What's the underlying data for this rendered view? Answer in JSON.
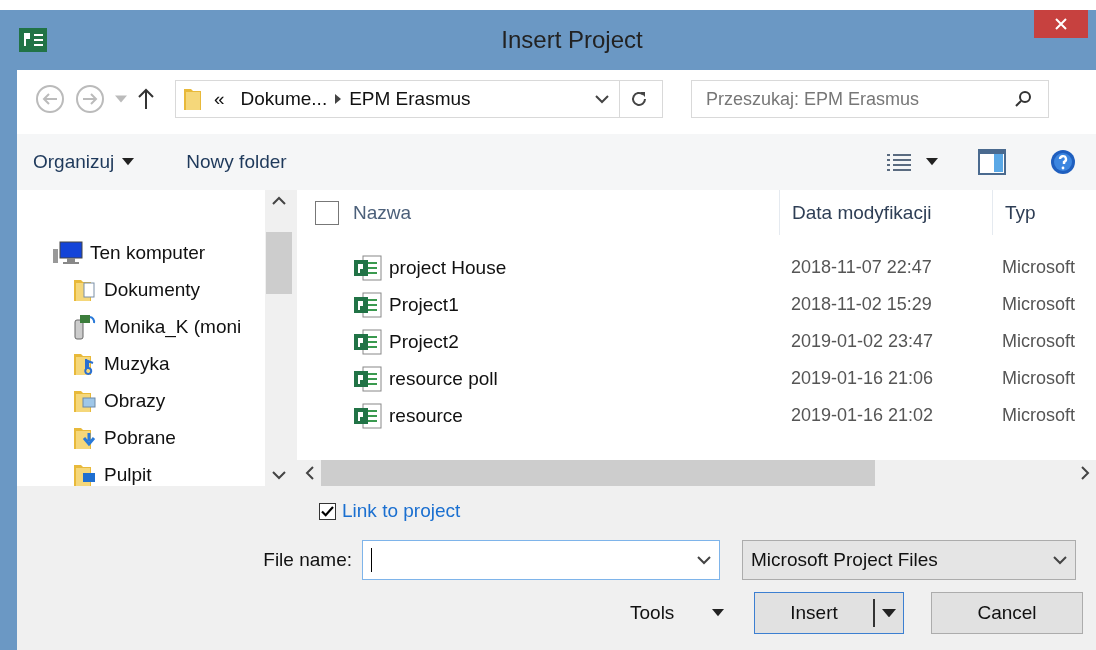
{
  "window": {
    "title": "Insert Project"
  },
  "address": {
    "overflow": "«",
    "crumbs": [
      "Dokume...",
      "EPM Erasmus"
    ]
  },
  "search": {
    "placeholder": "Przeszukaj: EPM Erasmus"
  },
  "toolbar": {
    "organize": "Organizuj",
    "new_folder": "Nowy folder"
  },
  "sidebar": {
    "items": [
      {
        "label": "Ten komputer",
        "kind": "computer",
        "children": [
          {
            "label": "Dokumenty",
            "kind": "documents"
          },
          {
            "label": "Monika_K (moni",
            "kind": "network"
          },
          {
            "label": "Muzyka",
            "kind": "music"
          },
          {
            "label": "Obrazy",
            "kind": "pictures"
          },
          {
            "label": "Pobrane",
            "kind": "downloads"
          },
          {
            "label": "Pulpit",
            "kind": "desktop"
          }
        ]
      }
    ]
  },
  "table": {
    "select_all": {
      "checked": false
    },
    "columns": [
      "Nazwa",
      "Data modyfikacji",
      "Typ"
    ],
    "rows": [
      {
        "name": "project House",
        "date": "2018-11-07 22:47",
        "type": "Microsoft"
      },
      {
        "name": "Project1",
        "date": "2018-11-02 15:29",
        "type": "Microsoft"
      },
      {
        "name": "Project2",
        "date": "2019-01-02 23:47",
        "type": "Microsoft"
      },
      {
        "name": "resource poll",
        "date": "2019-01-16 21:06",
        "type": "Microsoft"
      },
      {
        "name": "resource",
        "date": "2019-01-16 21:02",
        "type": "Microsoft"
      }
    ]
  },
  "link_option": {
    "label": "Link to project",
    "checked": true
  },
  "file_name": {
    "label": "File name:"
  },
  "file_type": {
    "value": "Microsoft Project Files"
  },
  "buttons": {
    "tools": "Tools",
    "insert": "Insert",
    "cancel": "Cancel"
  }
}
